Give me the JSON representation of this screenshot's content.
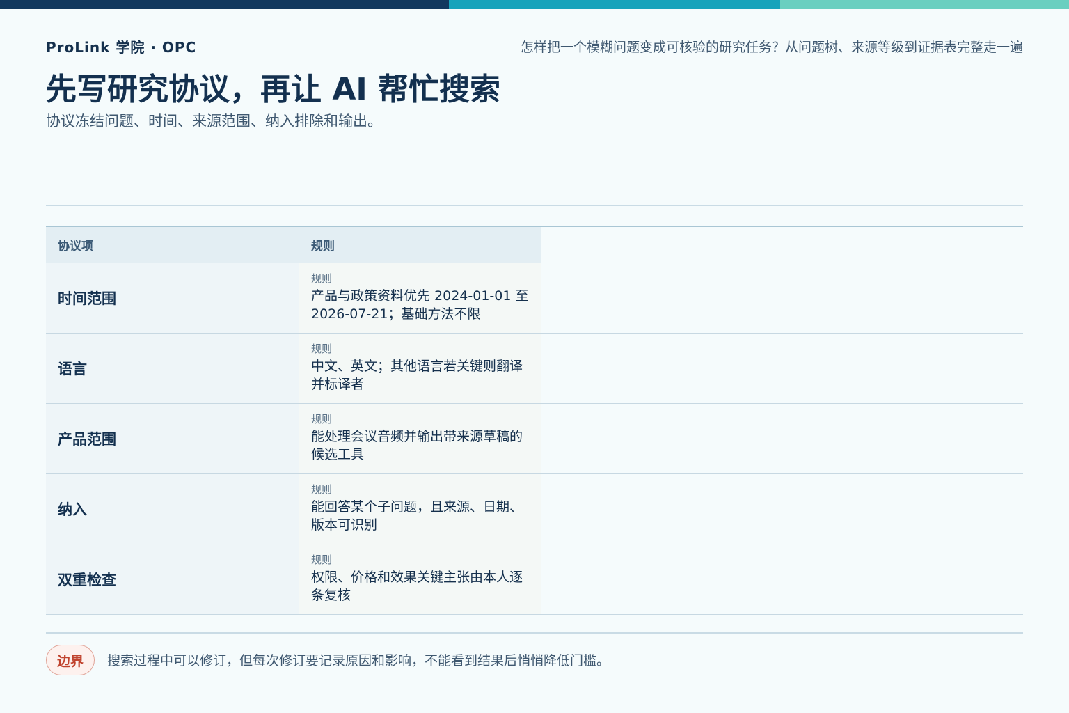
{
  "header": {
    "brand": "ProLink 学院 · OPC",
    "tagline": "怎样把一个模糊问题变成可核验的研究任务？从问题树、来源等级到证据表完整走一遍",
    "title": "先写研究协议，再让 AI 帮忙搜索",
    "subtitle": "协议冻结问题、时间、来源范围、纳入排除和输出。"
  },
  "colors": {
    "bar_dark": "#12385e",
    "bar_teal": "#17a3bb",
    "bar_mint": "#6acfc0",
    "badge_red": "#c0432e"
  },
  "table": {
    "headers": [
      "协议项",
      "规则"
    ],
    "rows": [
      {
        "item": "时间范围",
        "label": "规则",
        "rule": "产品与政策资料优先 2024-01-01 至 2026-07-21；基础方法不限"
      },
      {
        "item": "语言",
        "label": "规则",
        "rule": "中文、英文；其他语言若关键则翻译并标译者"
      },
      {
        "item": "产品范围",
        "label": "规则",
        "rule": "能处理会议音频并输出带来源草稿的候选工具"
      },
      {
        "item": "纳入",
        "label": "规则",
        "rule": "能回答某个子问题，且来源、日期、版本可识别"
      },
      {
        "item": "双重检查",
        "label": "规则",
        "rule": "权限、价格和效果关键主张由本人逐条复核"
      }
    ]
  },
  "footer": {
    "badge": "边界",
    "note": "搜索过程中可以修订，但每次修订要记录原因和影响，不能看到结果后悄悄降低门槛。"
  }
}
